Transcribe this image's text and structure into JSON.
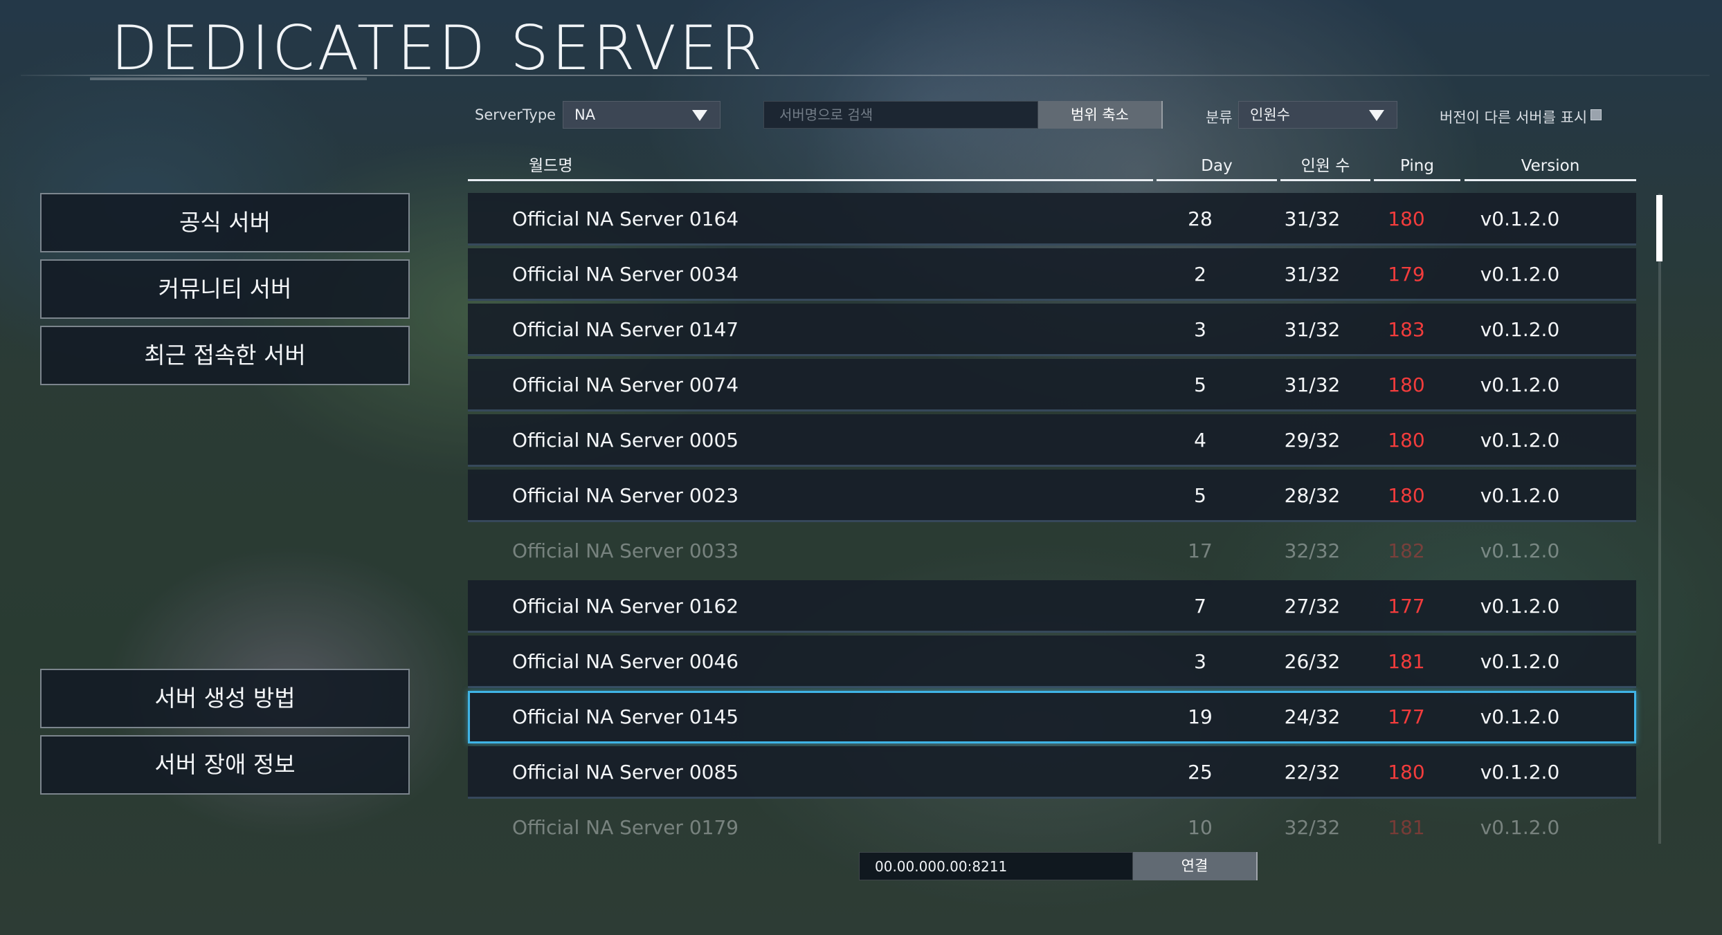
{
  "page": {
    "title": "DEDICATED SERVER"
  },
  "filters": {
    "server_type_label": "ServerType",
    "server_type_value": "NA",
    "search_placeholder": "서버명으로 검색",
    "search_button": "범위 축소",
    "sort_label": "분류",
    "sort_value": "인원수",
    "version_toggle_label": "버전이 다른 서버를 표시"
  },
  "nav": {
    "official": "공식 서버",
    "community": "커뮤니티 서버",
    "recent": "최근 접속한 서버",
    "howto": "서버 생성 방법",
    "outage": "서버 장애 정보"
  },
  "table": {
    "headers": {
      "world": "월드명",
      "day": "Day",
      "players": "인원 수",
      "ping": "Ping",
      "version": "Version"
    },
    "rows": [
      {
        "name": "Official NA Server 0164",
        "day": "28",
        "players": "31/32",
        "ping": "180",
        "version": "v0.1.2.0"
      },
      {
        "name": "Official NA Server 0034",
        "day": "2",
        "players": "31/32",
        "ping": "179",
        "version": "v0.1.2.0"
      },
      {
        "name": "Official NA Server 0147",
        "day": "3",
        "players": "31/32",
        "ping": "183",
        "version": "v0.1.2.0"
      },
      {
        "name": "Official NA Server 0074",
        "day": "5",
        "players": "31/32",
        "ping": "180",
        "version": "v0.1.2.0"
      },
      {
        "name": "Official NA Server 0005",
        "day": "4",
        "players": "29/32",
        "ping": "180",
        "version": "v0.1.2.0"
      },
      {
        "name": "Official NA Server 0023",
        "day": "5",
        "players": "28/32",
        "ping": "180",
        "version": "v0.1.2.0"
      },
      {
        "name": "Official NA Server 0033",
        "day": "17",
        "players": "32/32",
        "ping": "182",
        "version": "v0.1.2.0"
      },
      {
        "name": "Official NA Server 0162",
        "day": "7",
        "players": "27/32",
        "ping": "177",
        "version": "v0.1.2.0"
      },
      {
        "name": "Official NA Server 0046",
        "day": "3",
        "players": "26/32",
        "ping": "181",
        "version": "v0.1.2.0"
      },
      {
        "name": "Official NA Server 0145",
        "day": "19",
        "players": "24/32",
        "ping": "177",
        "version": "v0.1.2.0"
      },
      {
        "name": "Official NA Server 0085",
        "day": "25",
        "players": "22/32",
        "ping": "180",
        "version": "v0.1.2.0"
      },
      {
        "name": "Official NA Server 0179",
        "day": "10",
        "players": "32/32",
        "ping": "181",
        "version": "v0.1.2.0"
      }
    ]
  },
  "connect": {
    "ip_value": "00.00.000.00:8211",
    "button": "연결"
  },
  "colors": {
    "ping": "#f23c3c",
    "selection": "#3fb4e6"
  }
}
